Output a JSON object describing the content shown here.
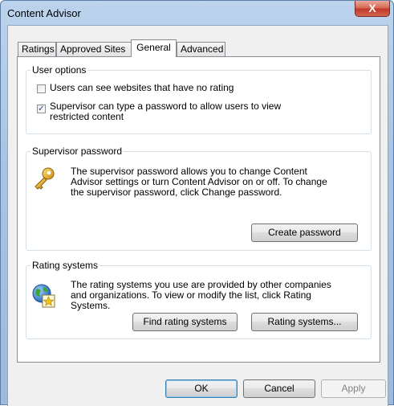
{
  "window": {
    "title": "Content Advisor",
    "close_label": "X"
  },
  "tabs": [
    {
      "label": "Ratings"
    },
    {
      "label": "Approved Sites"
    },
    {
      "label": "General"
    },
    {
      "label": "Advanced"
    }
  ],
  "active_tab": "General",
  "user_options": {
    "title": "User options",
    "no_rating_label": "Users can see websites that have no rating",
    "no_rating_checked": false,
    "supervisor_password_label": "Supervisor can type a password to allow users to view restricted content",
    "supervisor_password_checked": true
  },
  "supervisor_password": {
    "title": "Supervisor password",
    "description": "The supervisor password allows you to change Content Advisor settings or turn Content Advisor on or off. To change the supervisor password, click Change password.",
    "icon": "key-icon",
    "create_button": "Create password"
  },
  "rating_systems": {
    "title": "Rating systems",
    "description": "The rating systems you use are provided by other companies and organizations. To view or modify the list, click Rating Systems.",
    "icon": "globe-certificate-icon",
    "find_button": "Find rating systems",
    "systems_button": "Rating systems..."
  },
  "footer": {
    "ok": "OK",
    "cancel": "Cancel",
    "apply": "Apply"
  }
}
